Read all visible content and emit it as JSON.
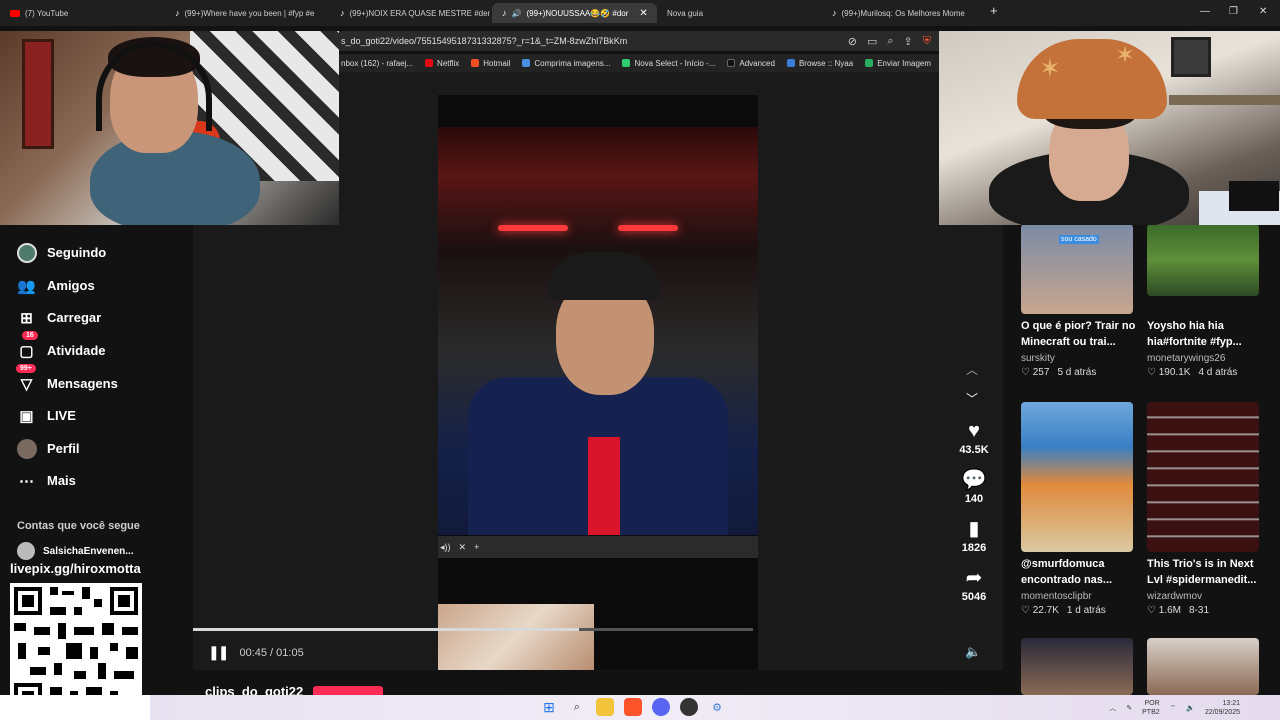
{
  "browser": {
    "tabs": [
      {
        "label": "(7) YouTube",
        "icon": "youtube-icon"
      },
      {
        "label": "(99+)Where have you been | #fyp #e",
        "icon": "tiktok-icon"
      },
      {
        "label": "(99+)NOIX ERA QUASE MESTRE #der",
        "icon": "tiktok-icon"
      },
      {
        "label": "(99+)NOUUSSAA😂🤣 #dor",
        "icon": "tiktok-icon"
      },
      {
        "label": "Nova guia",
        "icon": ""
      },
      {
        "label": "(99+)Murilosq: Os Melhores Mome",
        "icon": "tiktok-icon"
      }
    ],
    "new_tab": "+",
    "close_tab": "✕",
    "url": "s_do_goti22/video/7551549518731332875?_r=1&_t=ZM-8zwZhl7BkKm",
    "bookmarks": [
      {
        "label": "nbox (162) - rafaej...",
        "color": "#888888"
      },
      {
        "label": "Netflix",
        "color": "#e50914"
      },
      {
        "label": "Hotmail",
        "color": "#f25022"
      },
      {
        "label": "Comprima imagens...",
        "color": "#4a90e2"
      },
      {
        "label": "Nova Select - Início -...",
        "color": "#2ecc71"
      },
      {
        "label": "Advanced",
        "color": "#111111"
      },
      {
        "label": "Browse :: Nyaa",
        "color": "#3b7dd8"
      },
      {
        "label": "Enviar Imagem",
        "color": "#27ae60"
      }
    ]
  },
  "sidebar": {
    "items": [
      {
        "label": "Seguindo",
        "icon": "following-avatar-icon"
      },
      {
        "label": "Amigos",
        "icon": "friends-icon"
      },
      {
        "label": "Carregar",
        "icon": "upload-icon"
      },
      {
        "label": "Atividade",
        "icon": "activity-icon",
        "badge": "16"
      },
      {
        "label": "Mensagens",
        "icon": "messages-icon",
        "badge": "99+"
      },
      {
        "label": "LIVE",
        "icon": "live-icon"
      },
      {
        "label": "Perfil",
        "icon": "profile-avatar-icon"
      },
      {
        "label": "Mais",
        "icon": "more-icon"
      }
    ],
    "section_title": "Contas que você segue",
    "followed": [
      {
        "name": "SalsichaEnvenen..."
      }
    ],
    "overlay_link": "livepix.gg/hiroxmotta"
  },
  "player": {
    "time": "00:45 / 01:05",
    "progress": 0.69,
    "channel": "clips_do_goti22"
  },
  "actions": {
    "likes": "43.5K",
    "comments": "140",
    "saves": "1826",
    "shares": "5046"
  },
  "suggestions": [
    {
      "title": "O que é pior? Trair no Minecraft ou trai...",
      "author": "surskity",
      "likes": "257",
      "age": "5 d atrás",
      "thumb_text": "sou casado"
    },
    {
      "title": "Yoysho hia hia hia#fortnite #fyp...",
      "author": "monetarywings26",
      "likes": "190.1K",
      "age": "4 d atrás",
      "thumb_text": ""
    },
    {
      "title": "@smurfdomuca encontrado nas...",
      "author": "momentosclipbr",
      "likes": "22.7K",
      "age": "1 d atrás",
      "thumb_text": ""
    },
    {
      "title": "This Trio's is in Next Lvl #spidermanedit...",
      "author": "wizardwmov",
      "likes": "1.6M",
      "age": "8-31",
      "thumb_text": ""
    }
  ],
  "taskbar": {
    "lang_top": "POR",
    "lang_bottom": "PTB2",
    "time": "13:21",
    "date": "22/09/2025"
  }
}
